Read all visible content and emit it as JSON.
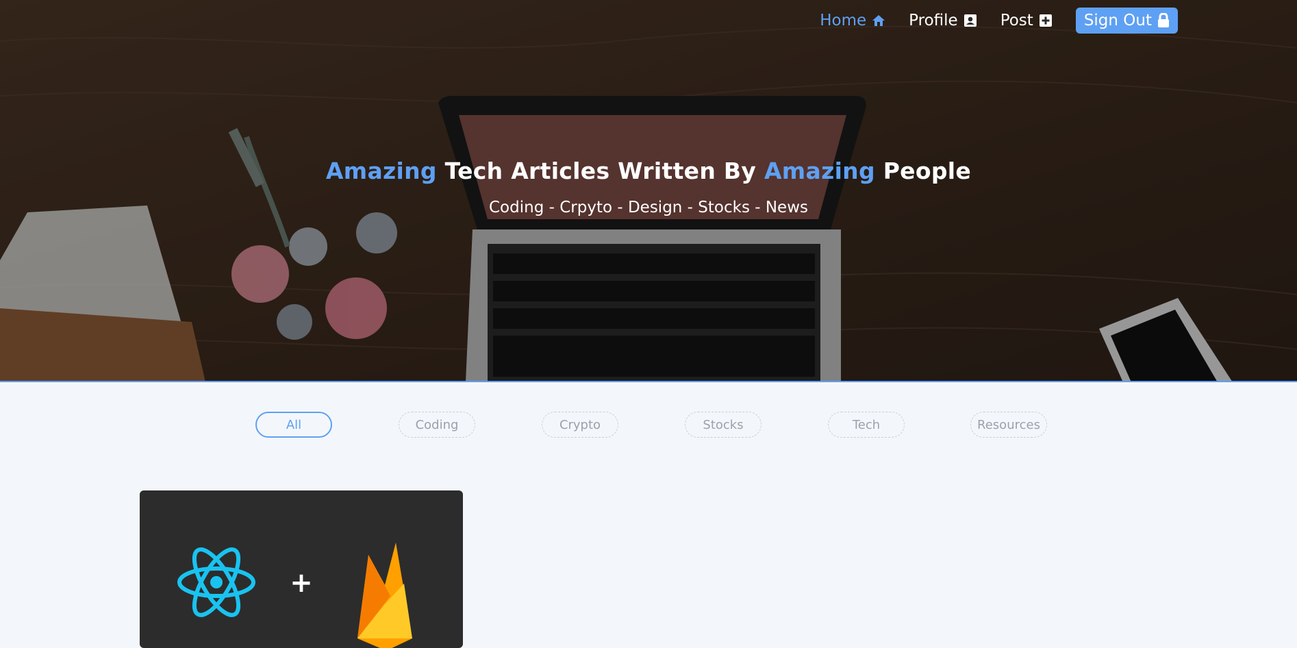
{
  "nav": {
    "home_label": "Home",
    "profile_label": "Profile",
    "post_label": "Post",
    "signout_label": "Sign Out"
  },
  "hero": {
    "title_part1": "Amazing",
    "title_part2": " Tech Articles Written By ",
    "title_part3": "Amazing",
    "title_part4": " People",
    "subtitle": "Coding - Crpyto - Design - Stocks - News"
  },
  "filters": {
    "items": [
      {
        "label": "All",
        "active": true
      },
      {
        "label": "Coding",
        "active": false
      },
      {
        "label": "Crypto",
        "active": false
      },
      {
        "label": "Stocks",
        "active": false
      },
      {
        "label": "Tech",
        "active": false
      },
      {
        "label": "Resources",
        "active": false
      }
    ]
  },
  "card": {
    "plus_symbol": "+"
  },
  "colors": {
    "accent": "#5ea0f3",
    "card_bg": "#2c2c2c",
    "page_bg": "#f3f7fc",
    "react_blue": "#19c3f0",
    "firebase_yellow": "#ffca28",
    "firebase_orange": "#f5a623"
  },
  "icons": {
    "home": "home-icon",
    "profile": "user-card-icon",
    "post": "plus-square-icon",
    "signout": "lock-icon",
    "react": "react-logo",
    "firebase": "firebase-logo"
  }
}
